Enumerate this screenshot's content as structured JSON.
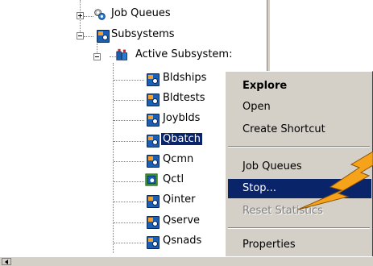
{
  "tree": {
    "job_queues": "Job Queues",
    "subsystems": "Subsystems",
    "active_subsystems": "Active Subsystem:",
    "items": [
      {
        "label": "Bldships"
      },
      {
        "label": "Bldtests"
      },
      {
        "label": "Joyblds"
      },
      {
        "label": "Qbatch"
      },
      {
        "label": "Qcmn"
      },
      {
        "label": "Qctl"
      },
      {
        "label": "Qinter"
      },
      {
        "label": "Qserve"
      },
      {
        "label": "Qsnads"
      }
    ],
    "selected_item": "Qbatch"
  },
  "context_menu": {
    "explore": "Explore",
    "open": "Open",
    "create_shortcut": "Create Shortcut",
    "job_queues": "Job Queues",
    "stop": "Stop...",
    "reset_statistics": "Reset Statistics",
    "properties": "Properties"
  },
  "colors": {
    "highlight": "#0a246a",
    "annotation_bolt": "#f7a21b"
  }
}
